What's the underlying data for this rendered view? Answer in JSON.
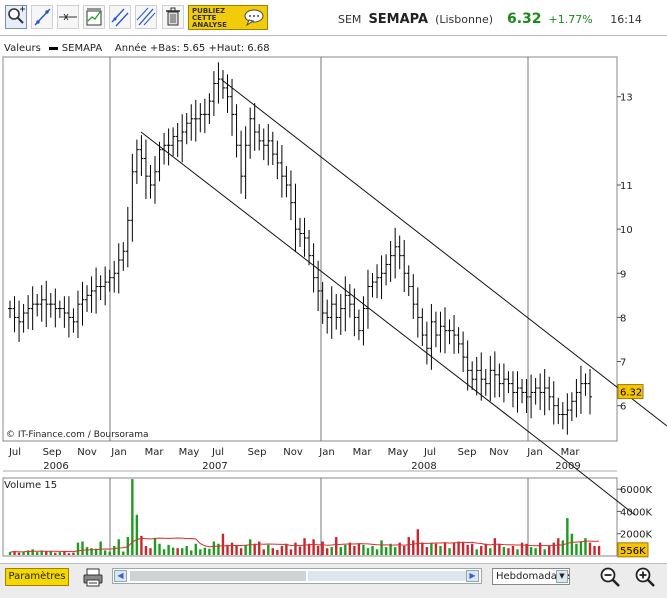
{
  "header": {
    "publish_label_1": "PUBLIEZ",
    "publish_label_2": "CETTE",
    "publish_label_3": "ANALYSE",
    "market": "SEM",
    "name": "SEMAPA",
    "exchange": "(Lisbonne)",
    "price": "6.32",
    "change": "+1.77%",
    "time": "16:14"
  },
  "legend": {
    "prefix": "Valeurs",
    "series": "SEMAPA",
    "range": "Année +Bas: 5.65 +Haut: 6.68"
  },
  "toolbar_icons": [
    "zoom-cursor-icon",
    "trendline-icon",
    "horizontal-line-icon",
    "indicators-icon",
    "parallel-channel-icon",
    "fibonacci-icon",
    "trash-icon"
  ],
  "chart_data": [
    {
      "type": "ohlc",
      "title": "",
      "copyright": "© IT-Finance.com / Boursorama",
      "x_ticks": [
        "Jul",
        "Sep",
        "Nov",
        "Jan",
        "Mar",
        "May",
        "Jul",
        "Sep",
        "Nov",
        "Jan",
        "Mar",
        "May",
        "Jul",
        "Sep",
        "Nov",
        "Jan",
        "Mar"
      ],
      "year_labels": [
        "2006",
        "2007",
        "2008",
        "2009"
      ],
      "y_ticks": [
        6,
        7,
        8,
        9,
        10,
        11,
        13
      ],
      "ylim": [
        5.2,
        13.9
      ],
      "last_price_label": "6.32",
      "grid": true,
      "close": [
        8.2,
        8.0,
        7.9,
        8.1,
        8.2,
        8.3,
        8.3,
        8.4,
        8.3,
        8.3,
        8.2,
        8.2,
        8.1,
        8.0,
        7.9,
        8.3,
        8.4,
        8.5,
        8.6,
        8.7,
        8.7,
        8.8,
        8.9,
        9.0,
        9.3,
        9.5,
        10.2,
        11.3,
        11.8,
        11.6,
        11.2,
        11.0,
        11.3,
        11.8,
        11.9,
        11.9,
        12.1,
        12.0,
        12.2,
        12.4,
        12.5,
        12.5,
        12.6,
        12.6,
        12.9,
        13.3,
        13.4,
        13.2,
        13.0,
        12.6,
        11.9,
        11.2,
        11.9,
        12.5,
        12.2,
        12.0,
        11.9,
        12.0,
        11.7,
        11.5,
        11.2,
        11.0,
        10.6,
        10.0,
        9.9,
        9.8,
        9.4,
        8.9,
        8.6,
        8.1,
        8.0,
        8.3,
        8.0,
        8.2,
        8.5,
        8.3,
        8.0,
        7.7,
        8.2,
        8.7,
        8.8,
        8.9,
        9.0,
        9.2,
        9.4,
        9.6,
        9.4,
        9.0,
        8.7,
        8.3,
        8.0,
        7.6,
        7.3,
        7.9,
        7.6,
        7.8,
        7.7,
        7.7,
        7.6,
        7.4,
        7.1,
        6.8,
        6.6,
        6.8,
        6.6,
        6.5,
        6.8,
        6.7,
        6.5,
        6.6,
        6.5,
        6.3,
        6.4,
        6.3,
        6.2,
        6.3,
        6.4,
        6.3,
        6.4,
        6.2,
        6.0,
        5.8,
        5.8,
        5.9,
        6.1,
        6.3,
        6.5,
        6.5,
        6.2
      ],
      "volume_label": "Volume 15",
      "volume_ticks": [
        "6000K",
        "4000K",
        "2000K"
      ],
      "volume_ylim": [
        0,
        7000
      ],
      "last_volume_label": "556K",
      "volume": [
        350,
        450,
        300,
        400,
        500,
        600,
        350,
        500,
        400,
        450,
        300,
        350,
        450,
        250,
        300,
        1200,
        1300,
        800,
        700,
        650,
        1300,
        500,
        400,
        900,
        1500,
        400,
        1700,
        6900,
        3700,
        1800,
        900,
        700,
        1600,
        1100,
        600,
        1000,
        750,
        700,
        700,
        900,
        500,
        1100,
        600,
        750,
        650,
        1300,
        1100,
        2000,
        1000,
        1200,
        900,
        700,
        1000,
        1500,
        1100,
        1300,
        600,
        1000,
        700,
        550,
        900,
        1100,
        600,
        1200,
        850,
        1600,
        1100,
        1500,
        900,
        1300,
        700,
        800,
        1700,
        800,
        1000,
        1200,
        900,
        1100,
        1000,
        700,
        900,
        600,
        1400,
        800,
        1100,
        800,
        1200,
        900,
        1700,
        1400,
        2400,
        1200,
        800,
        1200,
        1100,
        900,
        1200,
        700,
        1200,
        1300,
        1200,
        1000,
        1100,
        600,
        900,
        1100,
        700,
        1600,
        1100,
        800,
        700,
        900,
        600,
        1200,
        1100,
        800,
        700,
        1200,
        600,
        900,
        1200,
        1600,
        1400,
        3400,
        2000,
        1100,
        1300,
        1600,
        1200,
        900,
        900
      ],
      "volume_colors": {
        "up": "#1e9b1e",
        "down": "#c8282d",
        "average": "#d23030"
      }
    }
  ],
  "bottom": {
    "params_label": "Paramètres",
    "period_label": "Hebdomadaire"
  },
  "colors": {
    "accent": "#f2cc0a",
    "positive": "#1a8a1a",
    "panel": "#ececec"
  }
}
